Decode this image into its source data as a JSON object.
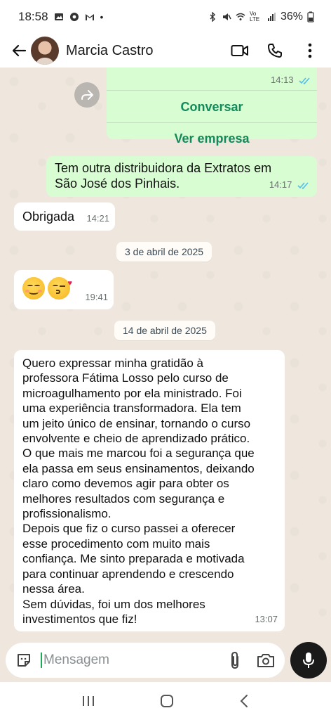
{
  "status_bar": {
    "time": "18:58",
    "battery": "36%",
    "network": "Vo LTE"
  },
  "header": {
    "contact_name": "Marcia Castro",
    "icons": [
      "back-arrow-icon",
      "video-call-icon",
      "phone-icon",
      "more-options-icon"
    ]
  },
  "messages": [
    {
      "id": "card",
      "type": "business-card",
      "direction": "out",
      "time": "14:13",
      "buttons": [
        "Conversar",
        "Ver empresa"
      ],
      "status": "read"
    },
    {
      "id": "m1",
      "direction": "out",
      "text": "Tem outra distribuidora da Extratos em São José dos Pinhais.",
      "time": "14:17",
      "status": "read"
    },
    {
      "id": "m2",
      "direction": "in",
      "text": "Obrigada",
      "time": "14:21"
    },
    {
      "id": "d1",
      "type": "date",
      "text": "3 de abril de 2025"
    },
    {
      "id": "m3",
      "direction": "in",
      "text": "😊😘",
      "time": "19:41"
    },
    {
      "id": "d2",
      "type": "date",
      "text": "14 de abril de 2025"
    },
    {
      "id": "m4",
      "direction": "in",
      "text": "Quero expressar minha gratidão à\nprofessora Fátima Losso pelo curso de\nmicroagulhamento por ela ministrado. Foi\numa experiência transformadora. Ela tem\num jeito único de ensinar, tornando o curso\nenvolvente e cheio de aprendizado prático.\nO que mais me marcou foi a segurança que\nela passa em seus ensinamentos, deixando\nclaro como devemos agir para obter os\nmelhores resultados com segurança e\nprofissionalismo.\nDepois que fiz o curso passei a oferecer\nesse procedimento com muito mais\nconfiança. Me sinto preparada e motivada\npara continuar aprendendo e crescendo\nnessa área.\nSem dúvidas, foi um dos melhores\ninvestimentos que fiz!",
      "time": "13:07"
    }
  ],
  "composer": {
    "placeholder": "Mensagem",
    "value": ""
  },
  "colors": {
    "outgoing_bubble": "#d9fdd3",
    "incoming_bubble": "#ffffff",
    "chat_background": "#efe7de",
    "read_ticks": "#53bdeb",
    "card_button_text": "#128a59"
  }
}
